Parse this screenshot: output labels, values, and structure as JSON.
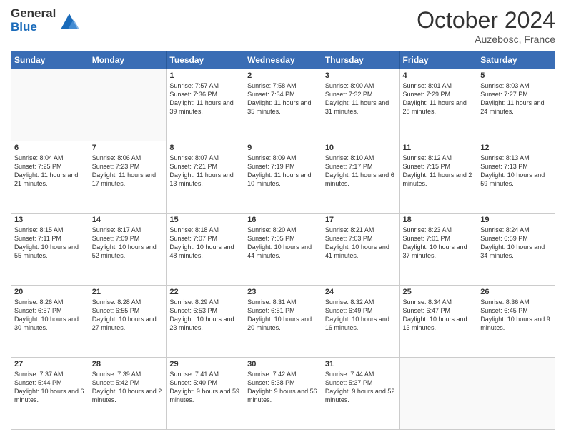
{
  "header": {
    "logo_line1": "General",
    "logo_line2": "Blue",
    "month": "October 2024",
    "location": "Auzebosc, France"
  },
  "days_of_week": [
    "Sunday",
    "Monday",
    "Tuesday",
    "Wednesday",
    "Thursday",
    "Friday",
    "Saturday"
  ],
  "weeks": [
    [
      {
        "num": "",
        "info": ""
      },
      {
        "num": "",
        "info": ""
      },
      {
        "num": "1",
        "info": "Sunrise: 7:57 AM\nSunset: 7:36 PM\nDaylight: 11 hours and 39 minutes."
      },
      {
        "num": "2",
        "info": "Sunrise: 7:58 AM\nSunset: 7:34 PM\nDaylight: 11 hours and 35 minutes."
      },
      {
        "num": "3",
        "info": "Sunrise: 8:00 AM\nSunset: 7:32 PM\nDaylight: 11 hours and 31 minutes."
      },
      {
        "num": "4",
        "info": "Sunrise: 8:01 AM\nSunset: 7:29 PM\nDaylight: 11 hours and 28 minutes."
      },
      {
        "num": "5",
        "info": "Sunrise: 8:03 AM\nSunset: 7:27 PM\nDaylight: 11 hours and 24 minutes."
      }
    ],
    [
      {
        "num": "6",
        "info": "Sunrise: 8:04 AM\nSunset: 7:25 PM\nDaylight: 11 hours and 21 minutes."
      },
      {
        "num": "7",
        "info": "Sunrise: 8:06 AM\nSunset: 7:23 PM\nDaylight: 11 hours and 17 minutes."
      },
      {
        "num": "8",
        "info": "Sunrise: 8:07 AM\nSunset: 7:21 PM\nDaylight: 11 hours and 13 minutes."
      },
      {
        "num": "9",
        "info": "Sunrise: 8:09 AM\nSunset: 7:19 PM\nDaylight: 11 hours and 10 minutes."
      },
      {
        "num": "10",
        "info": "Sunrise: 8:10 AM\nSunset: 7:17 PM\nDaylight: 11 hours and 6 minutes."
      },
      {
        "num": "11",
        "info": "Sunrise: 8:12 AM\nSunset: 7:15 PM\nDaylight: 11 hours and 2 minutes."
      },
      {
        "num": "12",
        "info": "Sunrise: 8:13 AM\nSunset: 7:13 PM\nDaylight: 10 hours and 59 minutes."
      }
    ],
    [
      {
        "num": "13",
        "info": "Sunrise: 8:15 AM\nSunset: 7:11 PM\nDaylight: 10 hours and 55 minutes."
      },
      {
        "num": "14",
        "info": "Sunrise: 8:17 AM\nSunset: 7:09 PM\nDaylight: 10 hours and 52 minutes."
      },
      {
        "num": "15",
        "info": "Sunrise: 8:18 AM\nSunset: 7:07 PM\nDaylight: 10 hours and 48 minutes."
      },
      {
        "num": "16",
        "info": "Sunrise: 8:20 AM\nSunset: 7:05 PM\nDaylight: 10 hours and 44 minutes."
      },
      {
        "num": "17",
        "info": "Sunrise: 8:21 AM\nSunset: 7:03 PM\nDaylight: 10 hours and 41 minutes."
      },
      {
        "num": "18",
        "info": "Sunrise: 8:23 AM\nSunset: 7:01 PM\nDaylight: 10 hours and 37 minutes."
      },
      {
        "num": "19",
        "info": "Sunrise: 8:24 AM\nSunset: 6:59 PM\nDaylight: 10 hours and 34 minutes."
      }
    ],
    [
      {
        "num": "20",
        "info": "Sunrise: 8:26 AM\nSunset: 6:57 PM\nDaylight: 10 hours and 30 minutes."
      },
      {
        "num": "21",
        "info": "Sunrise: 8:28 AM\nSunset: 6:55 PM\nDaylight: 10 hours and 27 minutes."
      },
      {
        "num": "22",
        "info": "Sunrise: 8:29 AM\nSunset: 6:53 PM\nDaylight: 10 hours and 23 minutes."
      },
      {
        "num": "23",
        "info": "Sunrise: 8:31 AM\nSunset: 6:51 PM\nDaylight: 10 hours and 20 minutes."
      },
      {
        "num": "24",
        "info": "Sunrise: 8:32 AM\nSunset: 6:49 PM\nDaylight: 10 hours and 16 minutes."
      },
      {
        "num": "25",
        "info": "Sunrise: 8:34 AM\nSunset: 6:47 PM\nDaylight: 10 hours and 13 minutes."
      },
      {
        "num": "26",
        "info": "Sunrise: 8:36 AM\nSunset: 6:45 PM\nDaylight: 10 hours and 9 minutes."
      }
    ],
    [
      {
        "num": "27",
        "info": "Sunrise: 7:37 AM\nSunset: 5:44 PM\nDaylight: 10 hours and 6 minutes."
      },
      {
        "num": "28",
        "info": "Sunrise: 7:39 AM\nSunset: 5:42 PM\nDaylight: 10 hours and 2 minutes."
      },
      {
        "num": "29",
        "info": "Sunrise: 7:41 AM\nSunset: 5:40 PM\nDaylight: 9 hours and 59 minutes."
      },
      {
        "num": "30",
        "info": "Sunrise: 7:42 AM\nSunset: 5:38 PM\nDaylight: 9 hours and 56 minutes."
      },
      {
        "num": "31",
        "info": "Sunrise: 7:44 AM\nSunset: 5:37 PM\nDaylight: 9 hours and 52 minutes."
      },
      {
        "num": "",
        "info": ""
      },
      {
        "num": "",
        "info": ""
      }
    ]
  ]
}
